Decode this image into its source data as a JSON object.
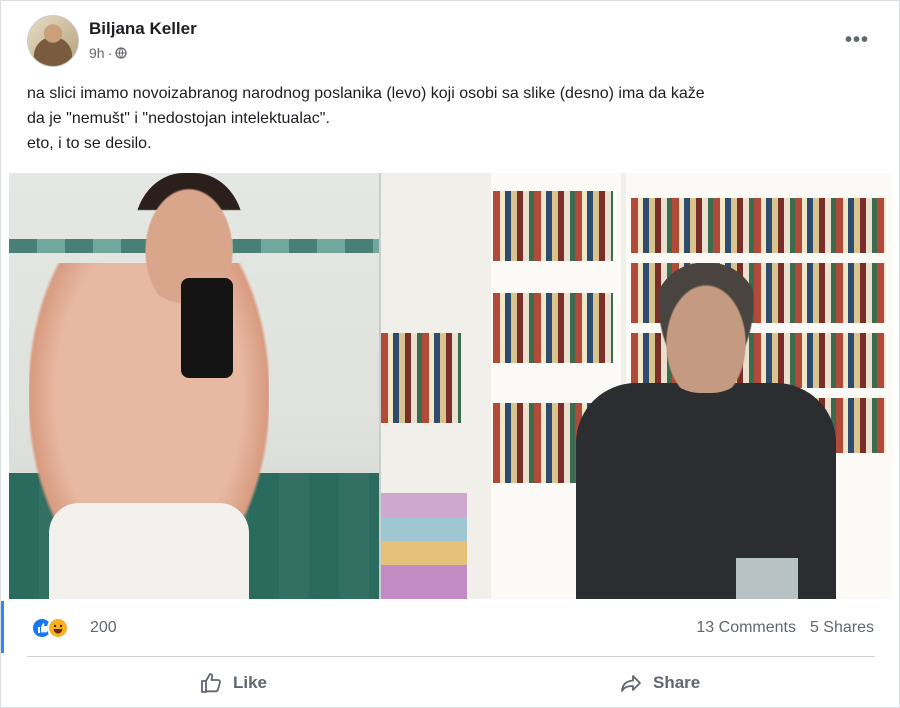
{
  "post": {
    "author": "Biljana Keller",
    "time": "9h",
    "separator": "·",
    "more_label": "•••",
    "text_lines": [
      "na slici imamo novoizabranog narodnog poslanika (levo) koji osobi sa slike (desno) ima da kaže",
      "da je \"nemušt\" i \"nedostojan intelektualac\".",
      "eto, i to se desilo."
    ]
  },
  "reactions": {
    "icons": [
      "like-icon",
      "haha-icon"
    ],
    "count": "200",
    "comments": "13 Comments",
    "shares": "5 Shares"
  },
  "actions": {
    "like_label": "Like",
    "share_label": "Share"
  },
  "colors": {
    "accent": "#1877f2",
    "haha": "#f7b125",
    "secondary_text": "#606770"
  }
}
